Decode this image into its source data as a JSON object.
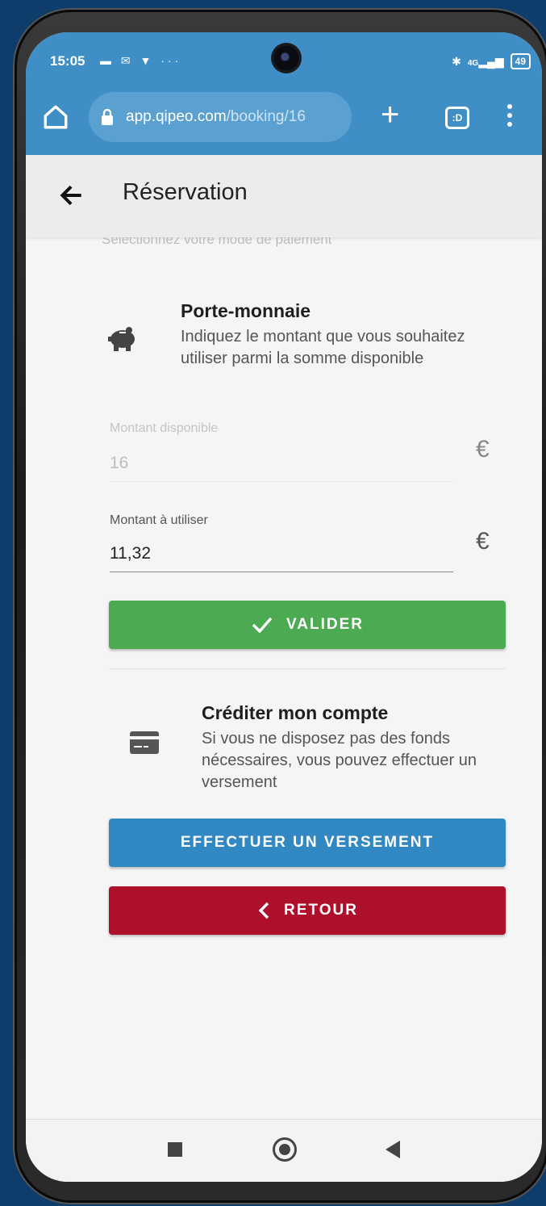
{
  "status": {
    "time": "15:05",
    "left_icons": "▬ ✉ ▼ ···",
    "network": "4G",
    "battery": "49"
  },
  "browser": {
    "url_domain": "app.qipeo.com",
    "url_path": "/booking/16",
    "tabs_label": ":D"
  },
  "appbar": {
    "title": "Réservation"
  },
  "faded_text": "Sélectionnez votre mode de paiement",
  "wallet": {
    "title": "Porte-monnaie",
    "description": "Indiquez le montant que vous souhaitez utiliser parmi la somme disponible",
    "available_label": "Montant disponible",
    "available_value": "16",
    "use_label": "Montant à utiliser",
    "use_value": "11,32",
    "currency": "€",
    "validate_label": "VALIDER"
  },
  "credit": {
    "title": "Créditer mon compte",
    "description": "Si vous ne disposez pas des fonds nécessaires, vous pouvez effectuer un versement",
    "deposit_label": "EFFECTUER UN VERSEMENT",
    "back_label": "RETOUR"
  },
  "colors": {
    "chrome": "#3f8fc6",
    "green": "#4caa52",
    "blue": "#3288c2",
    "red": "#ae0f2a"
  }
}
